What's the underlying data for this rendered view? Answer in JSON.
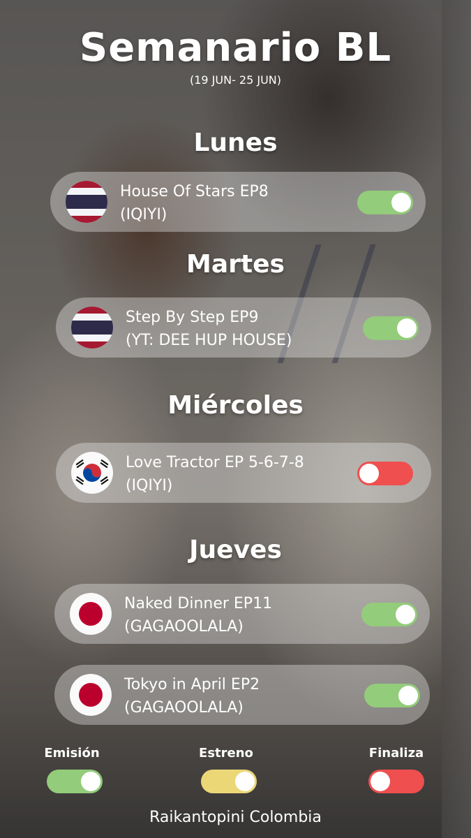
{
  "header": {
    "title": "Semanario BL",
    "date_range": "(19 JUN- 25 JUN)"
  },
  "days": [
    {
      "name": "Lunes",
      "shows": [
        {
          "title": "House Of Stars EP8",
          "platform": "(IQIYI)",
          "flag": "thailand-flag-icon",
          "status": "emision"
        }
      ]
    },
    {
      "name": "Martes",
      "shows": [
        {
          "title": "Step By Step EP9",
          "platform": "(YT: DEE HUP HOUSE)",
          "flag": "thailand-flag-icon",
          "status": "emision"
        }
      ]
    },
    {
      "name": "Miércoles",
      "shows": [
        {
          "title": "Love Tractor EP 5-6-7-8",
          "platform": "(IQIYI)",
          "flag": "south-korea-flag-icon",
          "status": "finaliza"
        }
      ]
    },
    {
      "name": "Jueves",
      "shows": [
        {
          "title": "Naked Dinner EP11",
          "platform": "(GAGAOOLALA)",
          "flag": "japan-flag-icon",
          "status": "emision"
        },
        {
          "title": "Tokyo in April EP2",
          "platform": "(GAGAOOLALA)",
          "flag": "japan-flag-icon",
          "status": "emision"
        }
      ]
    }
  ],
  "legend": {
    "emision": {
      "label": "Emisión",
      "color": "#93cc7a"
    },
    "estreno": {
      "label": "Estreno",
      "color": "#ecd777"
    },
    "finaliza": {
      "label": "Finaliza",
      "color": "#ef4f4f"
    }
  },
  "footer": {
    "credit": "Raikantopini Colombia"
  }
}
